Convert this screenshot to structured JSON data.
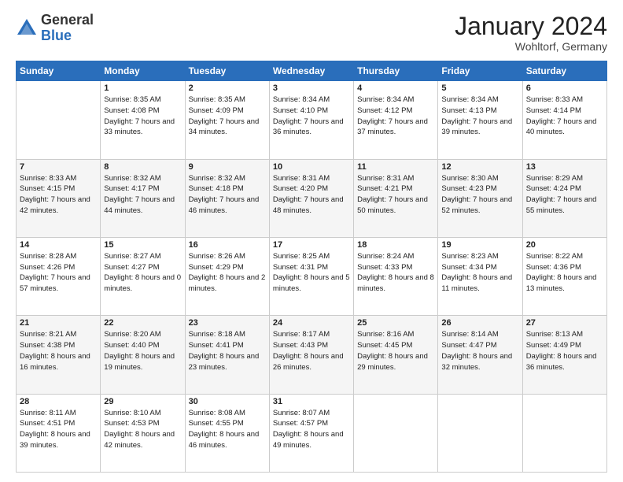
{
  "header": {
    "logo_general": "General",
    "logo_blue": "Blue",
    "month_title": "January 2024",
    "location": "Wohltorf, Germany"
  },
  "days_of_week": [
    "Sunday",
    "Monday",
    "Tuesday",
    "Wednesday",
    "Thursday",
    "Friday",
    "Saturday"
  ],
  "weeks": [
    [
      {
        "day": "",
        "sunrise": "",
        "sunset": "",
        "daylight": ""
      },
      {
        "day": "1",
        "sunrise": "Sunrise: 8:35 AM",
        "sunset": "Sunset: 4:08 PM",
        "daylight": "Daylight: 7 hours and 33 minutes."
      },
      {
        "day": "2",
        "sunrise": "Sunrise: 8:35 AM",
        "sunset": "Sunset: 4:09 PM",
        "daylight": "Daylight: 7 hours and 34 minutes."
      },
      {
        "day": "3",
        "sunrise": "Sunrise: 8:34 AM",
        "sunset": "Sunset: 4:10 PM",
        "daylight": "Daylight: 7 hours and 36 minutes."
      },
      {
        "day": "4",
        "sunrise": "Sunrise: 8:34 AM",
        "sunset": "Sunset: 4:12 PM",
        "daylight": "Daylight: 7 hours and 37 minutes."
      },
      {
        "day": "5",
        "sunrise": "Sunrise: 8:34 AM",
        "sunset": "Sunset: 4:13 PM",
        "daylight": "Daylight: 7 hours and 39 minutes."
      },
      {
        "day": "6",
        "sunrise": "Sunrise: 8:33 AM",
        "sunset": "Sunset: 4:14 PM",
        "daylight": "Daylight: 7 hours and 40 minutes."
      }
    ],
    [
      {
        "day": "7",
        "sunrise": "Sunrise: 8:33 AM",
        "sunset": "Sunset: 4:15 PM",
        "daylight": "Daylight: 7 hours and 42 minutes."
      },
      {
        "day": "8",
        "sunrise": "Sunrise: 8:32 AM",
        "sunset": "Sunset: 4:17 PM",
        "daylight": "Daylight: 7 hours and 44 minutes."
      },
      {
        "day": "9",
        "sunrise": "Sunrise: 8:32 AM",
        "sunset": "Sunset: 4:18 PM",
        "daylight": "Daylight: 7 hours and 46 minutes."
      },
      {
        "day": "10",
        "sunrise": "Sunrise: 8:31 AM",
        "sunset": "Sunset: 4:20 PM",
        "daylight": "Daylight: 7 hours and 48 minutes."
      },
      {
        "day": "11",
        "sunrise": "Sunrise: 8:31 AM",
        "sunset": "Sunset: 4:21 PM",
        "daylight": "Daylight: 7 hours and 50 minutes."
      },
      {
        "day": "12",
        "sunrise": "Sunrise: 8:30 AM",
        "sunset": "Sunset: 4:23 PM",
        "daylight": "Daylight: 7 hours and 52 minutes."
      },
      {
        "day": "13",
        "sunrise": "Sunrise: 8:29 AM",
        "sunset": "Sunset: 4:24 PM",
        "daylight": "Daylight: 7 hours and 55 minutes."
      }
    ],
    [
      {
        "day": "14",
        "sunrise": "Sunrise: 8:28 AM",
        "sunset": "Sunset: 4:26 PM",
        "daylight": "Daylight: 7 hours and 57 minutes."
      },
      {
        "day": "15",
        "sunrise": "Sunrise: 8:27 AM",
        "sunset": "Sunset: 4:27 PM",
        "daylight": "Daylight: 8 hours and 0 minutes."
      },
      {
        "day": "16",
        "sunrise": "Sunrise: 8:26 AM",
        "sunset": "Sunset: 4:29 PM",
        "daylight": "Daylight: 8 hours and 2 minutes."
      },
      {
        "day": "17",
        "sunrise": "Sunrise: 8:25 AM",
        "sunset": "Sunset: 4:31 PM",
        "daylight": "Daylight: 8 hours and 5 minutes."
      },
      {
        "day": "18",
        "sunrise": "Sunrise: 8:24 AM",
        "sunset": "Sunset: 4:33 PM",
        "daylight": "Daylight: 8 hours and 8 minutes."
      },
      {
        "day": "19",
        "sunrise": "Sunrise: 8:23 AM",
        "sunset": "Sunset: 4:34 PM",
        "daylight": "Daylight: 8 hours and 11 minutes."
      },
      {
        "day": "20",
        "sunrise": "Sunrise: 8:22 AM",
        "sunset": "Sunset: 4:36 PM",
        "daylight": "Daylight: 8 hours and 13 minutes."
      }
    ],
    [
      {
        "day": "21",
        "sunrise": "Sunrise: 8:21 AM",
        "sunset": "Sunset: 4:38 PM",
        "daylight": "Daylight: 8 hours and 16 minutes."
      },
      {
        "day": "22",
        "sunrise": "Sunrise: 8:20 AM",
        "sunset": "Sunset: 4:40 PM",
        "daylight": "Daylight: 8 hours and 19 minutes."
      },
      {
        "day": "23",
        "sunrise": "Sunrise: 8:18 AM",
        "sunset": "Sunset: 4:41 PM",
        "daylight": "Daylight: 8 hours and 23 minutes."
      },
      {
        "day": "24",
        "sunrise": "Sunrise: 8:17 AM",
        "sunset": "Sunset: 4:43 PM",
        "daylight": "Daylight: 8 hours and 26 minutes."
      },
      {
        "day": "25",
        "sunrise": "Sunrise: 8:16 AM",
        "sunset": "Sunset: 4:45 PM",
        "daylight": "Daylight: 8 hours and 29 minutes."
      },
      {
        "day": "26",
        "sunrise": "Sunrise: 8:14 AM",
        "sunset": "Sunset: 4:47 PM",
        "daylight": "Daylight: 8 hours and 32 minutes."
      },
      {
        "day": "27",
        "sunrise": "Sunrise: 8:13 AM",
        "sunset": "Sunset: 4:49 PM",
        "daylight": "Daylight: 8 hours and 36 minutes."
      }
    ],
    [
      {
        "day": "28",
        "sunrise": "Sunrise: 8:11 AM",
        "sunset": "Sunset: 4:51 PM",
        "daylight": "Daylight: 8 hours and 39 minutes."
      },
      {
        "day": "29",
        "sunrise": "Sunrise: 8:10 AM",
        "sunset": "Sunset: 4:53 PM",
        "daylight": "Daylight: 8 hours and 42 minutes."
      },
      {
        "day": "30",
        "sunrise": "Sunrise: 8:08 AM",
        "sunset": "Sunset: 4:55 PM",
        "daylight": "Daylight: 8 hours and 46 minutes."
      },
      {
        "day": "31",
        "sunrise": "Sunrise: 8:07 AM",
        "sunset": "Sunset: 4:57 PM",
        "daylight": "Daylight: 8 hours and 49 minutes."
      },
      {
        "day": "",
        "sunrise": "",
        "sunset": "",
        "daylight": ""
      },
      {
        "day": "",
        "sunrise": "",
        "sunset": "",
        "daylight": ""
      },
      {
        "day": "",
        "sunrise": "",
        "sunset": "",
        "daylight": ""
      }
    ]
  ]
}
